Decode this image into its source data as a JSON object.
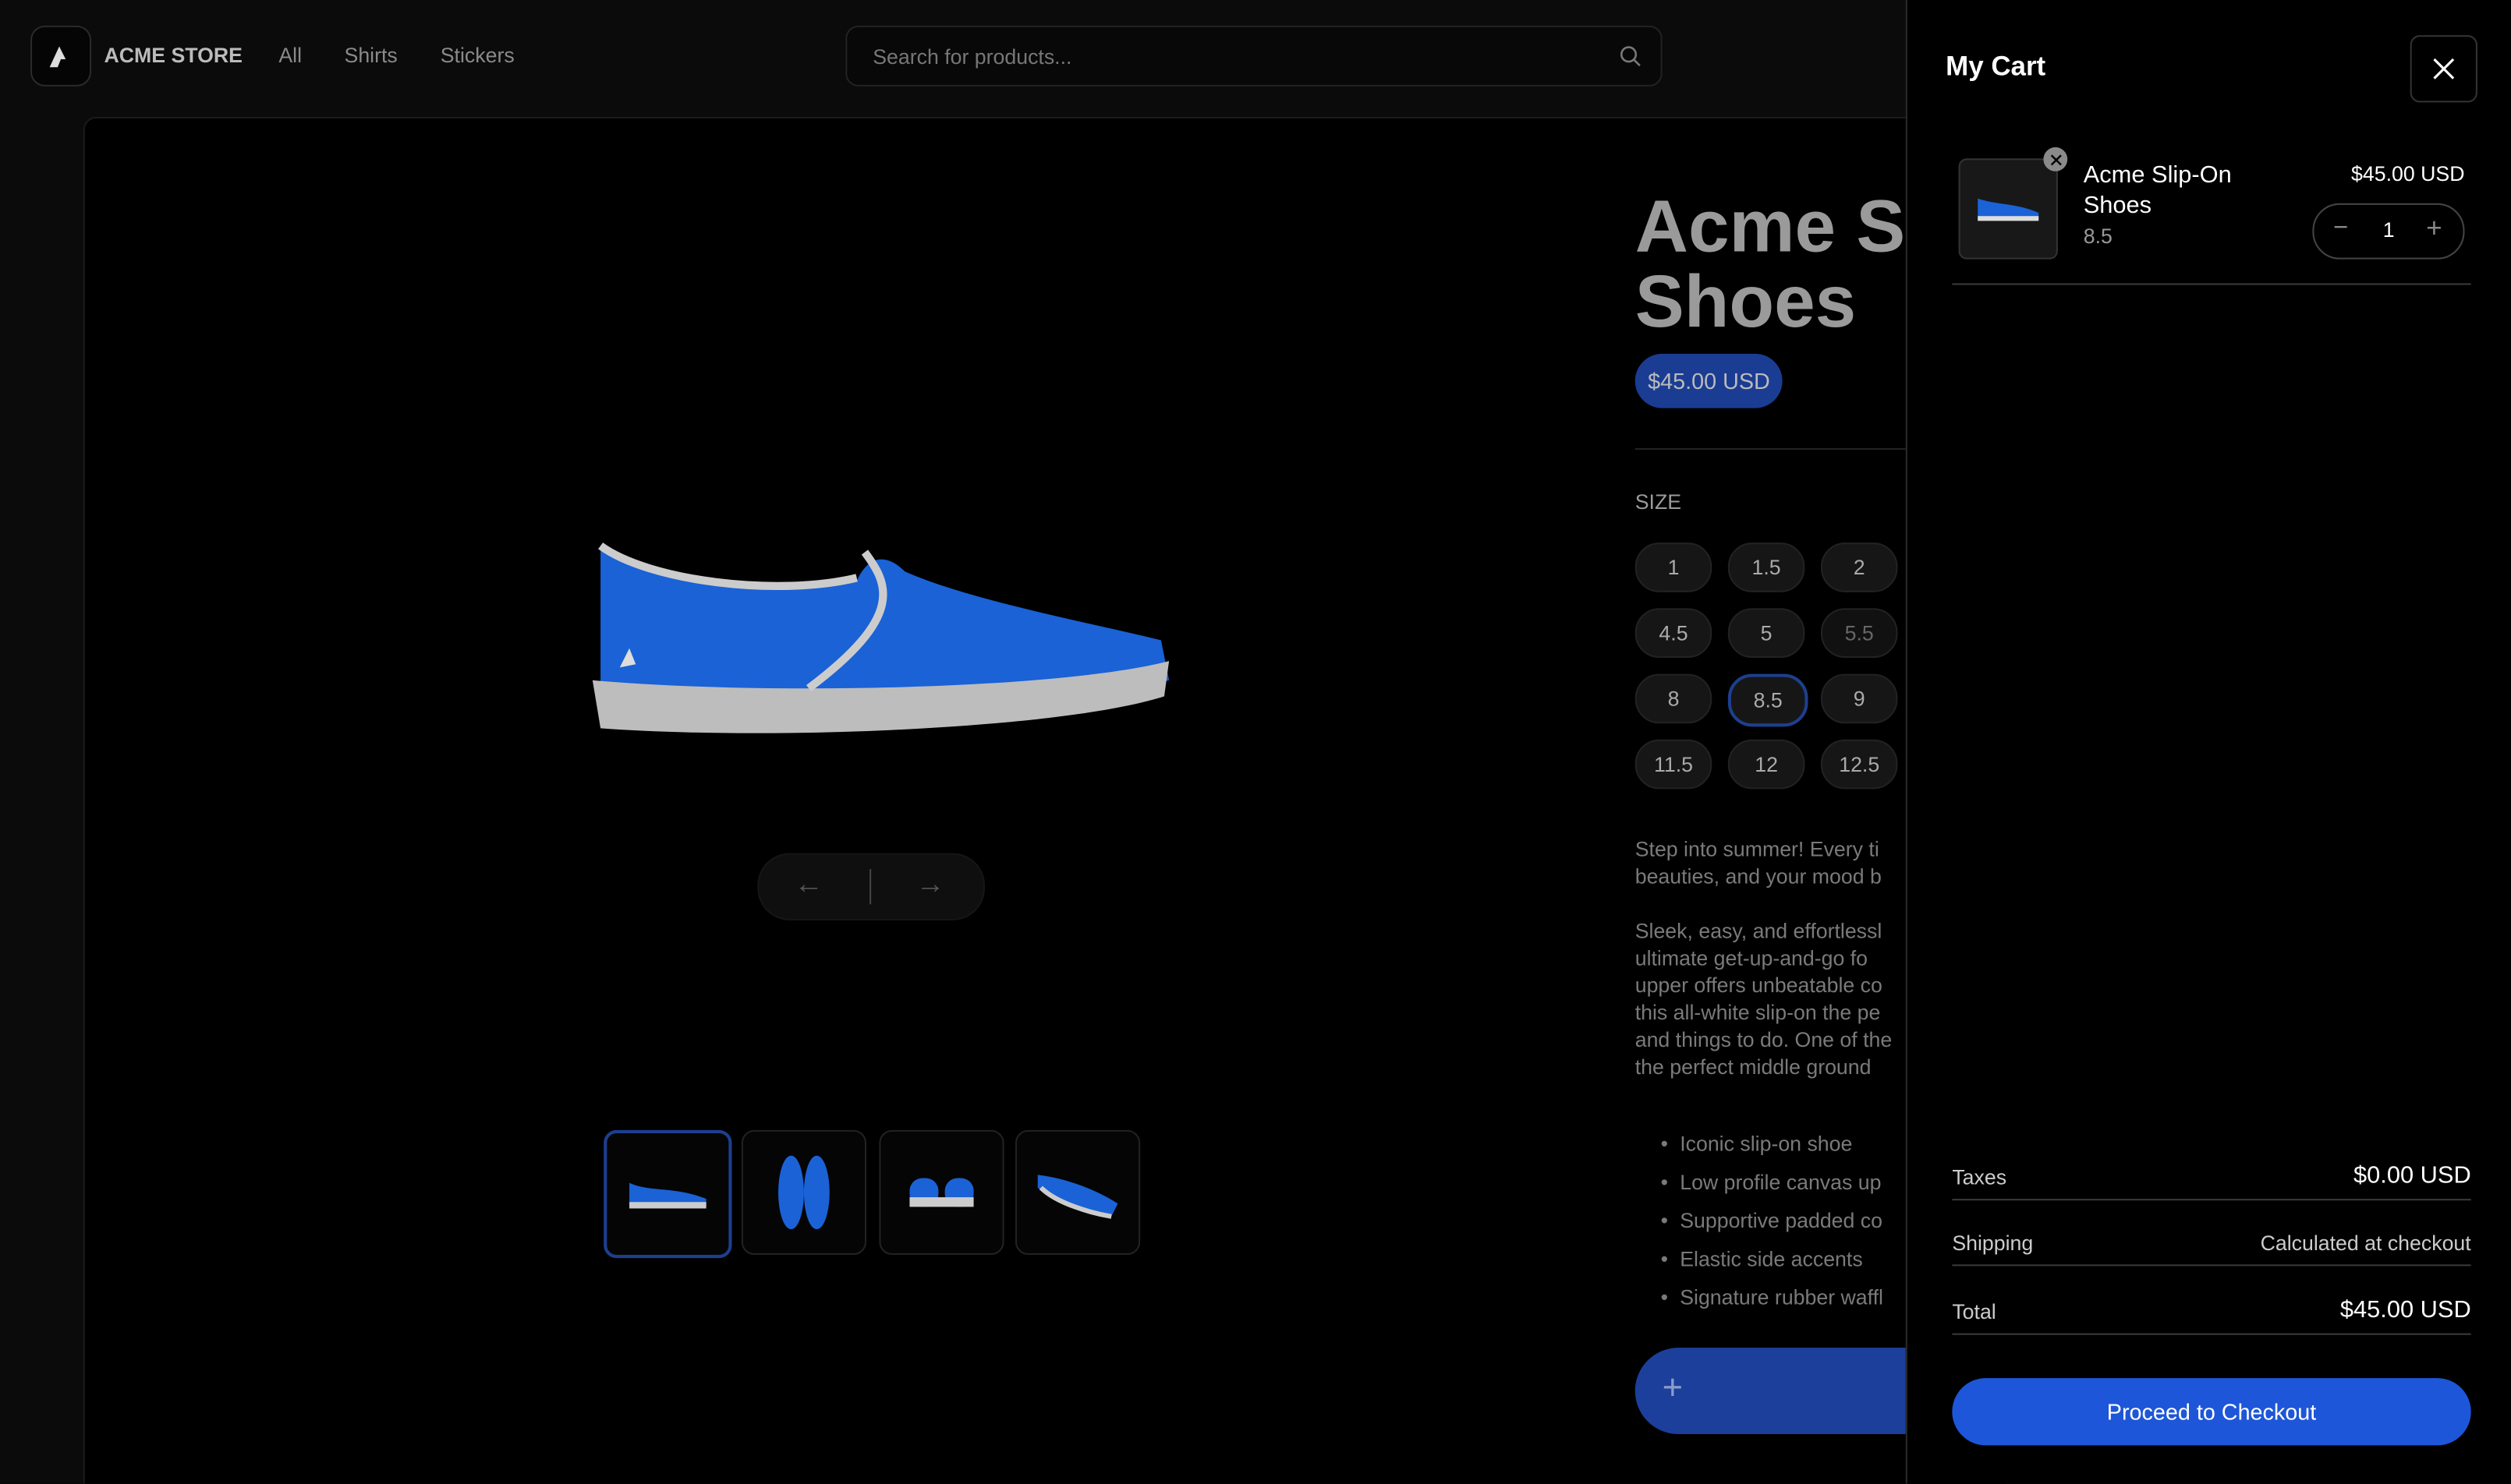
{
  "nav": {
    "brand": "ACME STORE",
    "links": [
      "All",
      "Shirts",
      "Stickers"
    ],
    "search_placeholder": "Search for products..."
  },
  "product": {
    "title_line1": "Acme S",
    "title_line2": "Shoes",
    "price": "$45.00 USD",
    "size_label": "SIZE",
    "sizes": [
      "1",
      "1.5",
      "2",
      "4.5",
      "5",
      "5.5",
      "8",
      "8.5",
      "9",
      "11.5",
      "12",
      "12.5"
    ],
    "selected_size": "8.5",
    "unavailable_size": "5.5",
    "description_visible": [
      "Step into summer! Every ti",
      "beauties, and your mood b",
      "",
      "Sleek, easy, and effortlessl",
      "ultimate get-up-and-go fo",
      "upper offers unbeatable co",
      "this all-white slip-on the pe",
      "and things to do. One of the",
      "the perfect middle ground"
    ],
    "bullets_visible": [
      "Iconic slip-on shoe",
      "Low profile canvas up",
      "Supportive padded co",
      "Elastic side accents",
      "Signature rubber waffl"
    ],
    "image_count": 4,
    "selected_image": 1
  },
  "cart": {
    "title": "My Cart",
    "item": {
      "name_line1": "Acme Slip-On",
      "name_line2": "Shoes",
      "variant": "8.5",
      "price": "$45.00 USD",
      "quantity": "1"
    },
    "taxes_label": "Taxes",
    "taxes": "$0.00 USD",
    "shipping_label": "Shipping",
    "shipping": "Calculated at checkout",
    "total_label": "Total",
    "total": "$45.00 USD",
    "checkout": "Proceed to Checkout"
  },
  "colors": {
    "accent": "#1d56d8",
    "shoe": "#1a62d6"
  }
}
